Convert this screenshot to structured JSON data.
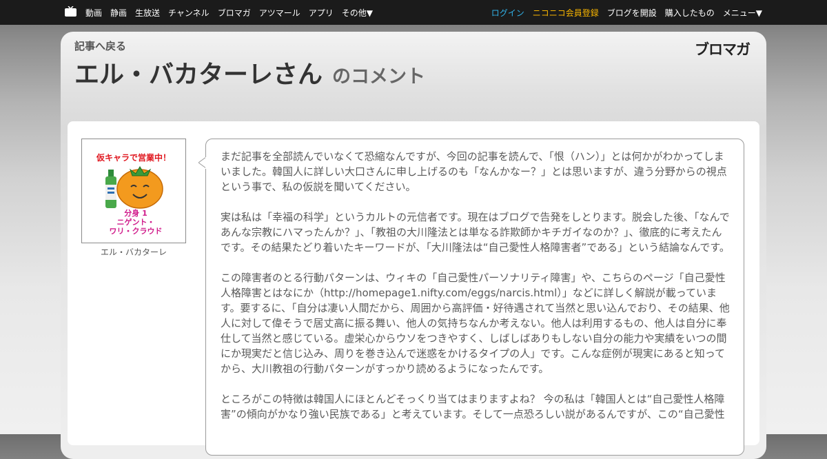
{
  "nav": {
    "left_items": [
      "動画",
      "静画",
      "生放送",
      "チャンネル",
      "ブロマガ",
      "アツマール",
      "アプリ",
      "その他▼"
    ],
    "login": "ログイン",
    "register": "ニコニコ会員登録",
    "right_items": [
      "ブログを開設",
      "購入したもの",
      "メニュー▼"
    ]
  },
  "header": {
    "back_label": "記事へ戻る",
    "author_title": "エル・バカターレさん",
    "title_suffix": "のコメント",
    "logo_text": "ブロマガ"
  },
  "comment": {
    "avatar_text": {
      "banner": "仮キャラで営業中！",
      "line1": "分身 1",
      "line2": "ニゲント・",
      "line3": "ワリ・クラウド"
    },
    "author_name": "エル・バカターレ",
    "body": "まだ記事を全部読んでいなくて恐縮なんですが、今回の記事を読んで、「恨（ハン）」とは何かがわかってしまいました。韓国人に詳しい大口さんに申し上げるのも「なんかなー？」とは思いますが、違う分野からの視点という事で、私の仮説を聞いてください。\n\n実は私は「幸福の科学」というカルトの元信者です。現在はブログで告発をしとります。脱会した後、「なんであんな宗教にハマったんか？」、「教祖の大川隆法とは単なる詐欺師かキチガイなのか？」、徹底的に考えたんです。その結果たどり着いたキーワードが、「大川隆法は“自己愛性人格障害者”である」という結論なんです。\n\nこの障害者のとる行動パターンは、ウィキの「自己愛性パーソナリティ障害」や、こちらのページ「自己愛性人格障害とはなにか（http://homepage1.nifty.com/eggs/narcis.html）」などに詳しく解説が載っています。要するに、「自分は凄い人間だから、周囲から高評価・好待遇されて当然と思い込んでおり、その結果、他人に対して偉そうで居丈高に振る舞い、他人の気持ちなんか考えない。他人は利用するもの、他人は自分に奉仕して当然と感じている。虚栄心からウソをつきやすく、しばしばありもしない自分の能力や実績をいつの間にか現実だと信じ込み、周りを巻き込んで迷惑をかけるタイプの人」です。こんな症例が現実にあると知ってから、大川教祖の行動パターンがすっかり読めるようになったんです。\n\nところがこの特徴は韓国人にほとんどそっくり当てはまりますよね？ 今の私は「韓国人とは“自己愛性人格障害”の傾向がかなり強い民族である」と考えています。そして一点恐ろしい説があるんですが、この“自己愛性"
  },
  "colors": {
    "topbar_bg": "#1b1b1b",
    "login": "#31b2e8",
    "register": "#f8b500",
    "tomato": "#f39a1e",
    "banner_text": "#e0161e"
  },
  "icons": [
    "tv-icon",
    "tail-pointer"
  ]
}
